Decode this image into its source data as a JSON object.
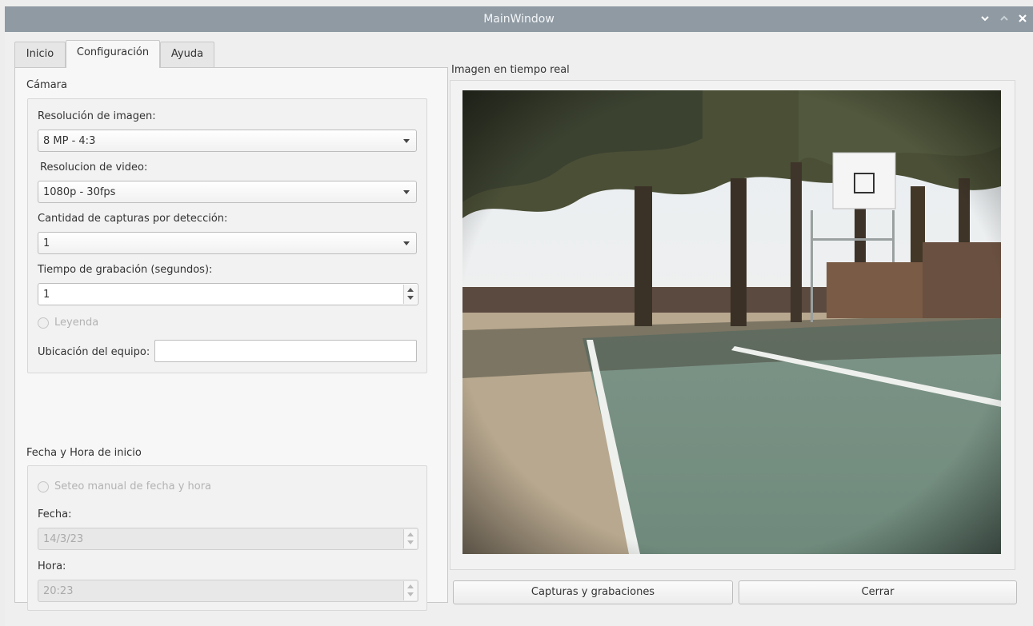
{
  "window": {
    "title": "MainWindow"
  },
  "tabs": [
    {
      "label": "Inicio",
      "active": false
    },
    {
      "label": "Configuración",
      "active": true
    },
    {
      "label": "Ayuda",
      "active": false
    }
  ],
  "camera": {
    "group_title": "Cámara",
    "image_resolution_label": "Resolución de imagen:",
    "image_resolution_value": "8 MP - 4:3",
    "video_resolution_label": "Resolucion de video:",
    "video_resolution_value": "1080p - 30fps",
    "captures_label": "Cantidad de capturas por detección:",
    "captures_value": "1",
    "recording_time_label": "Tiempo de grabación (segundos):",
    "recording_time_value": "1",
    "legend_radio_label": "Leyenda",
    "location_label": "Ubicación del equipo:",
    "location_value": ""
  },
  "datetime": {
    "group_title": "Fecha y Hora de inicio",
    "manual_radio_label": "Seteo manual de fecha y hora",
    "date_label": "Fecha:",
    "date_value": "14/3/23",
    "time_label": "Hora:",
    "time_value": "20:23"
  },
  "preview": {
    "title": "Imagen en tiempo real"
  },
  "buttons": {
    "captures_label": "Capturas y grabaciones",
    "close_label": "Cerrar"
  },
  "colors": {
    "titlebar": "#8f9aa3",
    "window_bg": "#efefef"
  }
}
